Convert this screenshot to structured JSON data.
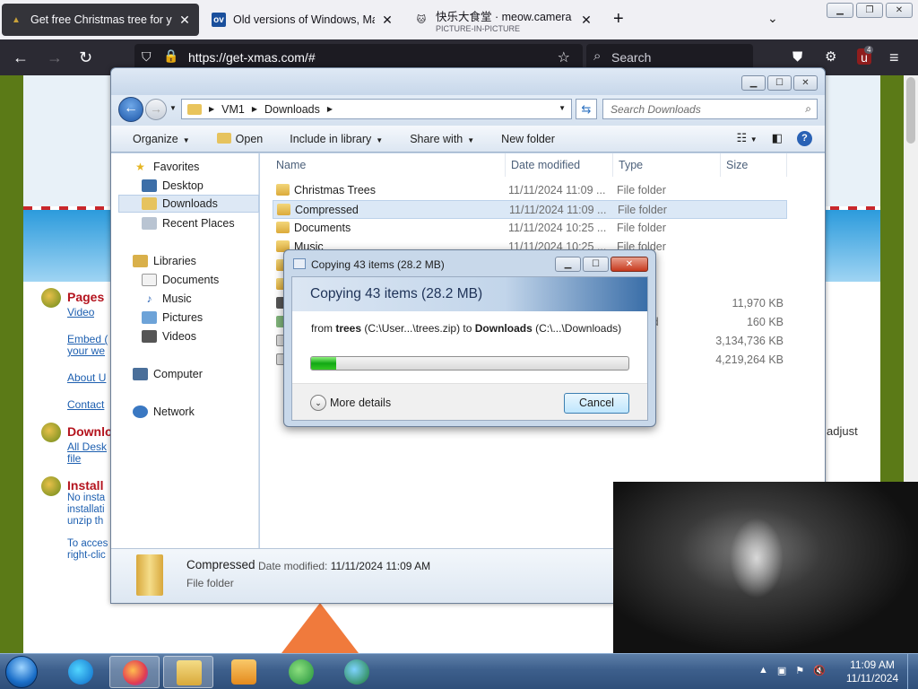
{
  "browser": {
    "tabs": [
      {
        "title": "Get free Christmas tree for your",
        "subtitle": "",
        "active": true
      },
      {
        "title": "Old versions of Windows, Mac",
        "subtitle": "",
        "active": false,
        "favicon_text": "ov"
      },
      {
        "title": "快乐大食堂 · meow.camera",
        "subtitle": "PICTURE-IN-PICTURE",
        "active": false
      }
    ],
    "url_host": "https://get-xmas.com/#",
    "search_placeholder": "Search",
    "addon_badge": "4"
  },
  "page": {
    "links": [
      {
        "heading": "Pages",
        "lines": [
          "Video"
        ]
      },
      {
        "heading": "",
        "lines": [
          "Embed (",
          "your we"
        ]
      },
      {
        "heading": "",
        "lines": [
          "About U"
        ]
      },
      {
        "heading": "",
        "lines": [
          "Contact"
        ]
      },
      {
        "heading": "Downlo",
        "lines": [
          "All Desk",
          "file"
        ]
      },
      {
        "heading": "Install",
        "lines": [
          "No insta",
          "installati",
          "unzip th"
        ]
      },
      {
        "heading": "",
        "lines": [
          "To acces",
          "right-clic"
        ]
      }
    ],
    "adjust_text": "adjust"
  },
  "explorer": {
    "breadcrumb": [
      "VM1",
      "Downloads"
    ],
    "search_placeholder": "Search Downloads",
    "toolbar": {
      "organize": "Organize",
      "open": "Open",
      "include": "Include in library",
      "share": "Share with",
      "new_folder": "New folder"
    },
    "nav": {
      "favorites": "Favorites",
      "desktop": "Desktop",
      "downloads": "Downloads",
      "recent": "Recent Places",
      "libraries": "Libraries",
      "documents": "Documents",
      "music": "Music",
      "pictures": "Pictures",
      "videos": "Videos",
      "computer": "Computer",
      "network": "Network"
    },
    "columns": {
      "name": "Name",
      "date": "Date modified",
      "type": "Type",
      "size": "Size"
    },
    "files": [
      {
        "name": "Christmas Trees",
        "date": "11/11/2024 11:09 ...",
        "type": "File folder",
        "size": ""
      },
      {
        "name": "Compressed",
        "date": "11/11/2024 11:09 ...",
        "type": "File folder",
        "size": ""
      },
      {
        "name": "Documents",
        "date": "11/11/2024 10:25 ...",
        "type": "File folder",
        "size": ""
      },
      {
        "name": "Music",
        "date": "11/11/2024 10:25 ...",
        "type": "File folder",
        "size": ""
      },
      {
        "name": "",
        "date": "",
        "type": "er",
        "size": ""
      },
      {
        "name": "",
        "date": "",
        "type": "er",
        "size": ""
      },
      {
        "name": "",
        "date": "",
        "type": "ion",
        "size": "11,970 KB"
      },
      {
        "name": "",
        "date": "",
        "type": "ownload",
        "size": "160 KB"
      },
      {
        "name": "",
        "date": "",
        "type": "ge File",
        "size": "3,134,736 KB"
      },
      {
        "name": "",
        "date": "",
        "type": "ge File",
        "size": "4,219,264 KB"
      }
    ],
    "details": {
      "name": "Compressed",
      "date_label": "Date modified:",
      "date_value": "11/11/2024 11:09 AM",
      "type": "File folder"
    }
  },
  "copy_dialog": {
    "title": "Copying 43 items (28.2 MB)",
    "heading": "Copying 43 items (28.2 MB)",
    "from_label": "from",
    "source_name": "trees",
    "source_path": "(C:\\User...\\trees.zip)",
    "to_label": "to",
    "dest_name": "Downloads",
    "dest_path": "(C:\\...\\Downloads)",
    "progress_fraction": 0.08,
    "more_details": "More details",
    "cancel": "Cancel"
  },
  "taskbar": {
    "clock_time": "11:09 AM",
    "clock_date": "11/11/2024"
  }
}
